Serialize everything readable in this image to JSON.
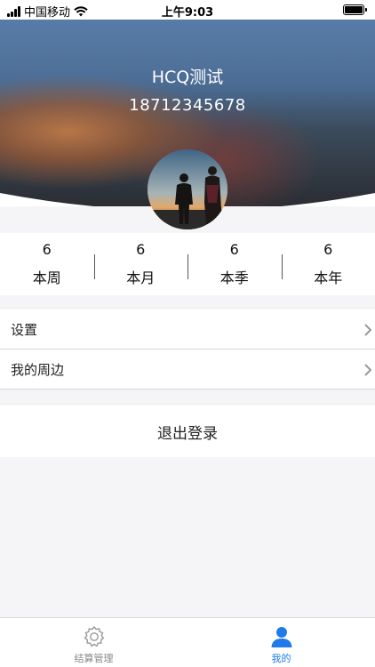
{
  "status_bar": {
    "carrier": "中国移动",
    "time": "上午9:03"
  },
  "profile": {
    "name": "HCQ测试",
    "phone": "18712345678"
  },
  "stats": [
    {
      "value": "6",
      "label": "本周"
    },
    {
      "value": "6",
      "label": "本月"
    },
    {
      "value": "6",
      "label": "本季"
    },
    {
      "value": "6",
      "label": "本年"
    }
  ],
  "menu": {
    "settings_label": "设置",
    "nearby_label": "我的周边"
  },
  "logout_label": "退出登录",
  "tabbar": {
    "tabs": [
      {
        "label": "结算管理",
        "icon": "gear-icon",
        "active": false
      },
      {
        "label": "我的",
        "icon": "person-icon",
        "active": true
      }
    ],
    "active_color": "#1f7bea",
    "inactive_color": "#888888"
  }
}
